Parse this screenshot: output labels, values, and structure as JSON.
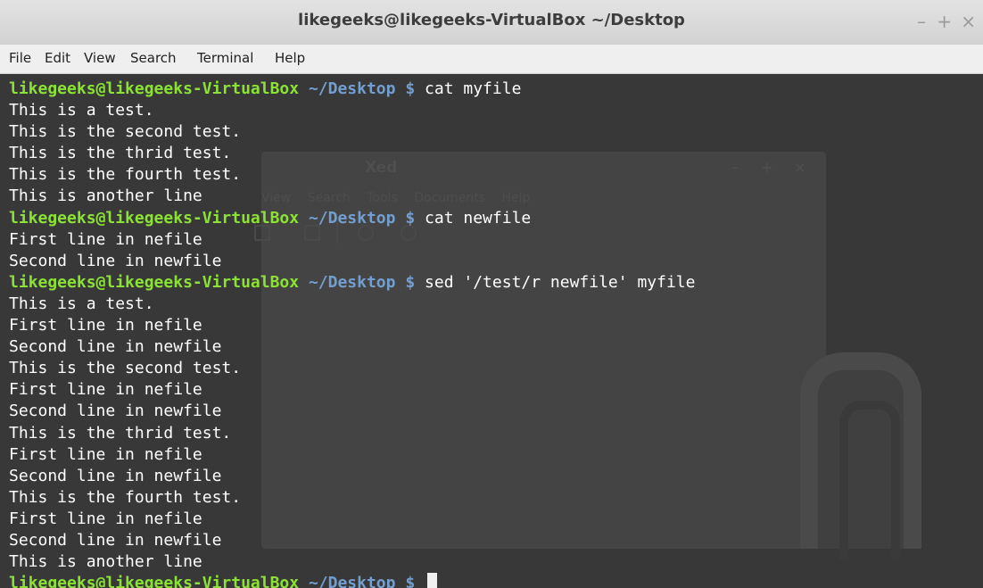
{
  "window": {
    "title": "likegeeks@likegeeks-VirtualBox ~/Desktop",
    "controls": {
      "minimize": "–",
      "maximize": "+",
      "close": "×"
    }
  },
  "menubar": {
    "items": [
      "File",
      "Edit",
      "View",
      "Search",
      "Terminal",
      "Help"
    ]
  },
  "prompt": {
    "user_host": "likegeeks@likegeeks-VirtualBox",
    "path": "~/Desktop",
    "symbol": "$"
  },
  "background_window": {
    "title": "Xed",
    "controls": {
      "minimize": "–",
      "maximize": "+",
      "close": "×"
    },
    "menu": [
      "View",
      "Search",
      "Tools",
      "Documents",
      "Help"
    ]
  },
  "terminal": {
    "lines": [
      {
        "type": "prompt",
        "command": "cat myfile"
      },
      {
        "type": "output",
        "text": "This is a test."
      },
      {
        "type": "output",
        "text": "This is the second test."
      },
      {
        "type": "output",
        "text": "This is the thrid test."
      },
      {
        "type": "output",
        "text": "This is the fourth test."
      },
      {
        "type": "output",
        "text": "This is another line"
      },
      {
        "type": "prompt",
        "command": "cat newfile"
      },
      {
        "type": "output",
        "text": "First line in nefile"
      },
      {
        "type": "output",
        "text": "Second line in newfile"
      },
      {
        "type": "prompt",
        "command": "sed '/test/r newfile' myfile"
      },
      {
        "type": "output",
        "text": "This is a test."
      },
      {
        "type": "output",
        "text": "First line in nefile"
      },
      {
        "type": "output",
        "text": "Second line in newfile"
      },
      {
        "type": "output",
        "text": "This is the second test."
      },
      {
        "type": "output",
        "text": "First line in nefile"
      },
      {
        "type": "output",
        "text": "Second line in newfile"
      },
      {
        "type": "output",
        "text": "This is the thrid test."
      },
      {
        "type": "output",
        "text": "First line in nefile"
      },
      {
        "type": "output",
        "text": "Second line in newfile"
      },
      {
        "type": "output",
        "text": "This is the fourth test."
      },
      {
        "type": "output",
        "text": "First line in nefile"
      },
      {
        "type": "output",
        "text": "Second line in newfile"
      },
      {
        "type": "output",
        "text": "This is another line"
      },
      {
        "type": "prompt",
        "command": "",
        "cursor": true
      }
    ]
  }
}
